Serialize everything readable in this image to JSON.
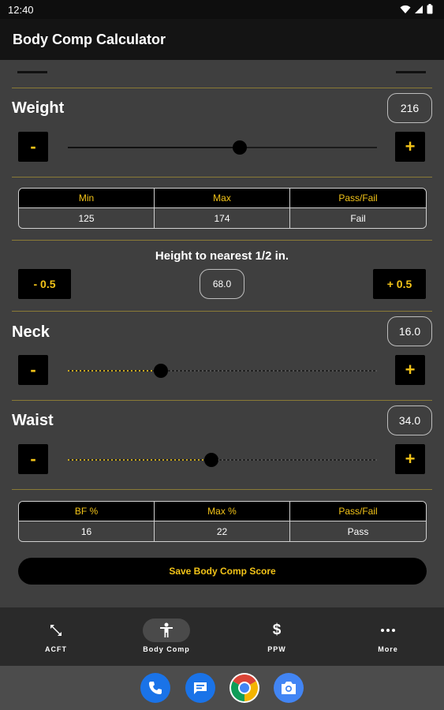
{
  "status": {
    "time": "12:40"
  },
  "app": {
    "title": "Body Comp Calculator"
  },
  "weight": {
    "label": "Weight",
    "value": "216",
    "minus_label": "-",
    "plus_label": "+",
    "slider_fraction": 0.555
  },
  "weight_table": {
    "headers": [
      "Min",
      "Max",
      "Pass/Fail"
    ],
    "values": [
      "125",
      "174",
      "Fail"
    ]
  },
  "height": {
    "title": "Height to nearest 1/2 in.",
    "minus_label": "- 0.5",
    "plus_label": "+ 0.5",
    "value": "68.0"
  },
  "neck": {
    "label": "Neck",
    "value": "16.0",
    "minus_label": "-",
    "plus_label": "+",
    "slider_fraction": 0.3
  },
  "waist": {
    "label": "Waist",
    "value": "34.0",
    "minus_label": "-",
    "plus_label": "+",
    "slider_fraction": 0.465
  },
  "bf_table": {
    "headers": [
      "BF %",
      "Max %",
      "Pass/Fail"
    ],
    "values": [
      "16",
      "22",
      "Pass"
    ]
  },
  "save_button": {
    "label": "Save Body Comp Score"
  },
  "nav": {
    "items": [
      {
        "label": "ACFT",
        "icon": "expand-arrows-icon",
        "active": false
      },
      {
        "label": "Body Comp",
        "icon": "person-icon",
        "active": true
      },
      {
        "label": "PPW",
        "icon": "dollar-icon",
        "active": false
      },
      {
        "label": "More",
        "icon": "more-dots-icon",
        "active": false
      }
    ]
  },
  "dock": {
    "icons": [
      "phone-icon",
      "messages-icon",
      "chrome-icon",
      "camera-icon"
    ]
  },
  "colors": {
    "accent": "#f2c318",
    "background": "#3f3f3f",
    "appbar": "#141414",
    "divider": "#8a7a36"
  }
}
